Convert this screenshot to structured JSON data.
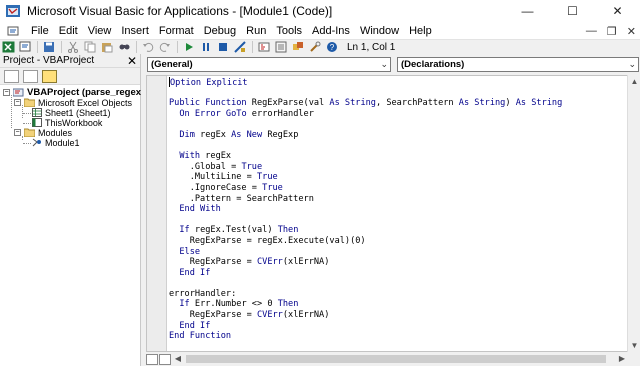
{
  "window": {
    "title": "Microsoft Visual Basic for Applications - [Module1 (Code)]",
    "minimize": "—",
    "maximize": "☐",
    "close": "✕"
  },
  "menu": {
    "items": [
      "File",
      "Edit",
      "View",
      "Insert",
      "Format",
      "Debug",
      "Run",
      "Tools",
      "Add-Ins",
      "Window",
      "Help"
    ],
    "doc_min": "—",
    "doc_restore": "❐",
    "doc_close": "✕"
  },
  "toolbar": {
    "position": "Ln 1, Col 1"
  },
  "project": {
    "header": "Project - VBAProject",
    "close": "✕",
    "tree": {
      "root": "VBAProject (parse_regex.xls",
      "excel_objects": "Microsoft Excel Objects",
      "sheet1": "Sheet1 (Sheet1)",
      "workbook": "ThisWorkbook",
      "modules": "Modules",
      "module1": "Module1"
    }
  },
  "editor": {
    "object_combo": "(General)",
    "proc_combo": "(Declarations)",
    "keywords_color": "#00008b"
  },
  "code_lines": [
    [
      [
        "kw",
        "Option Explicit"
      ]
    ],
    [],
    [
      [
        "kw",
        "Public Function"
      ],
      [
        "t",
        " RegExParse(val "
      ],
      [
        "kw",
        "As String"
      ],
      [
        "t",
        ", SearchPattern "
      ],
      [
        "kw",
        "As String"
      ],
      [
        "t",
        ") "
      ],
      [
        "kw",
        "As String"
      ]
    ],
    [
      [
        "t",
        "  "
      ],
      [
        "kw",
        "On Error GoTo"
      ],
      [
        "t",
        " errorHandler"
      ]
    ],
    [],
    [
      [
        "t",
        "  "
      ],
      [
        "kw",
        "Dim"
      ],
      [
        "t",
        " regEx "
      ],
      [
        "kw",
        "As New"
      ],
      [
        "t",
        " RegExp"
      ]
    ],
    [],
    [
      [
        "t",
        "  "
      ],
      [
        "kw",
        "With"
      ],
      [
        "t",
        " regEx"
      ]
    ],
    [
      [
        "t",
        "    .Global = "
      ],
      [
        "kw",
        "True"
      ]
    ],
    [
      [
        "t",
        "    .MultiLine = "
      ],
      [
        "kw",
        "True"
      ]
    ],
    [
      [
        "t",
        "    .IgnoreCase = "
      ],
      [
        "kw",
        "True"
      ]
    ],
    [
      [
        "t",
        "    .Pattern = SearchPattern"
      ]
    ],
    [
      [
        "t",
        "  "
      ],
      [
        "kw",
        "End With"
      ]
    ],
    [],
    [
      [
        "t",
        "  "
      ],
      [
        "kw",
        "If"
      ],
      [
        "t",
        " regEx.Test(val) "
      ],
      [
        "kw",
        "Then"
      ]
    ],
    [
      [
        "t",
        "    RegExParse = regEx.Execute(val)(0)"
      ]
    ],
    [
      [
        "t",
        "  "
      ],
      [
        "kw",
        "Else"
      ]
    ],
    [
      [
        "t",
        "    RegExParse = "
      ],
      [
        "kw",
        "CVErr"
      ],
      [
        "t",
        "(xlErrNA)"
      ]
    ],
    [
      [
        "t",
        "  "
      ],
      [
        "kw",
        "End If"
      ]
    ],
    [],
    [
      [
        "t",
        "errorHandler:"
      ]
    ],
    [
      [
        "t",
        "  "
      ],
      [
        "kw",
        "If"
      ],
      [
        "t",
        " Err.Number <> 0 "
      ],
      [
        "kw",
        "Then"
      ]
    ],
    [
      [
        "t",
        "    RegExParse = "
      ],
      [
        "kw",
        "CVErr"
      ],
      [
        "t",
        "(xlErrNA)"
      ]
    ],
    [
      [
        "t",
        "  "
      ],
      [
        "kw",
        "End If"
      ]
    ],
    [
      [
        "kw",
        "End Function"
      ]
    ]
  ]
}
